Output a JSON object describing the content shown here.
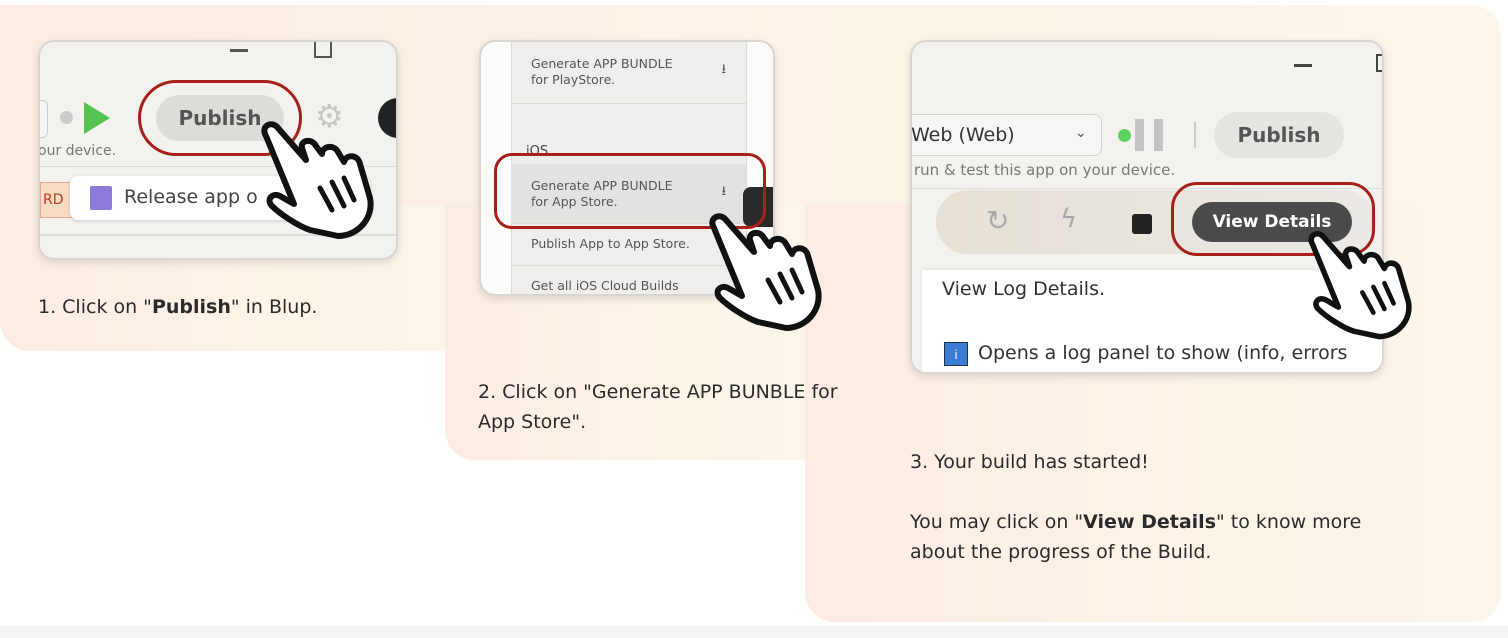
{
  "step1": {
    "publish_label": "Publish",
    "hint_text": "our device.",
    "tag_text": "RD",
    "release_text": "Release app o",
    "caption_pre": "1. Click on \"",
    "caption_bold": "Publish",
    "caption_post": "\" in Blup."
  },
  "step2": {
    "menu": [
      {
        "label": "Generate APP BUNDLE\nfor PlayStore.",
        "icon": "download-icon"
      },
      {
        "label": "iOS"
      },
      {
        "label": "Generate APP BUNDLE\nfor App Store.",
        "icon": "download-icon"
      },
      {
        "label": "Publish App to App Store."
      },
      {
        "label": "Get all iOS Cloud Builds"
      }
    ],
    "caption": "2. Click on \"Generate APP BUNBLE for App Store\"."
  },
  "step3": {
    "platform_select": "Web (Web)",
    "publish_label": "Publish",
    "hint_text": "run & test this app on your device.",
    "view_details_label": "View Details",
    "tooltip_title": "View Log Details.",
    "tooltip_body": "Opens a log panel to show (info, errors",
    "caption_line1": "3. Your build has started!",
    "caption2_pre": "You may click on \"",
    "caption2_bold": "View Details",
    "caption2_post": "\" to know more about the progress of the Build."
  },
  "colors": {
    "highlight_ring": "#a8201a",
    "status_green": "#5fd35f",
    "play_green": "#56c254"
  }
}
